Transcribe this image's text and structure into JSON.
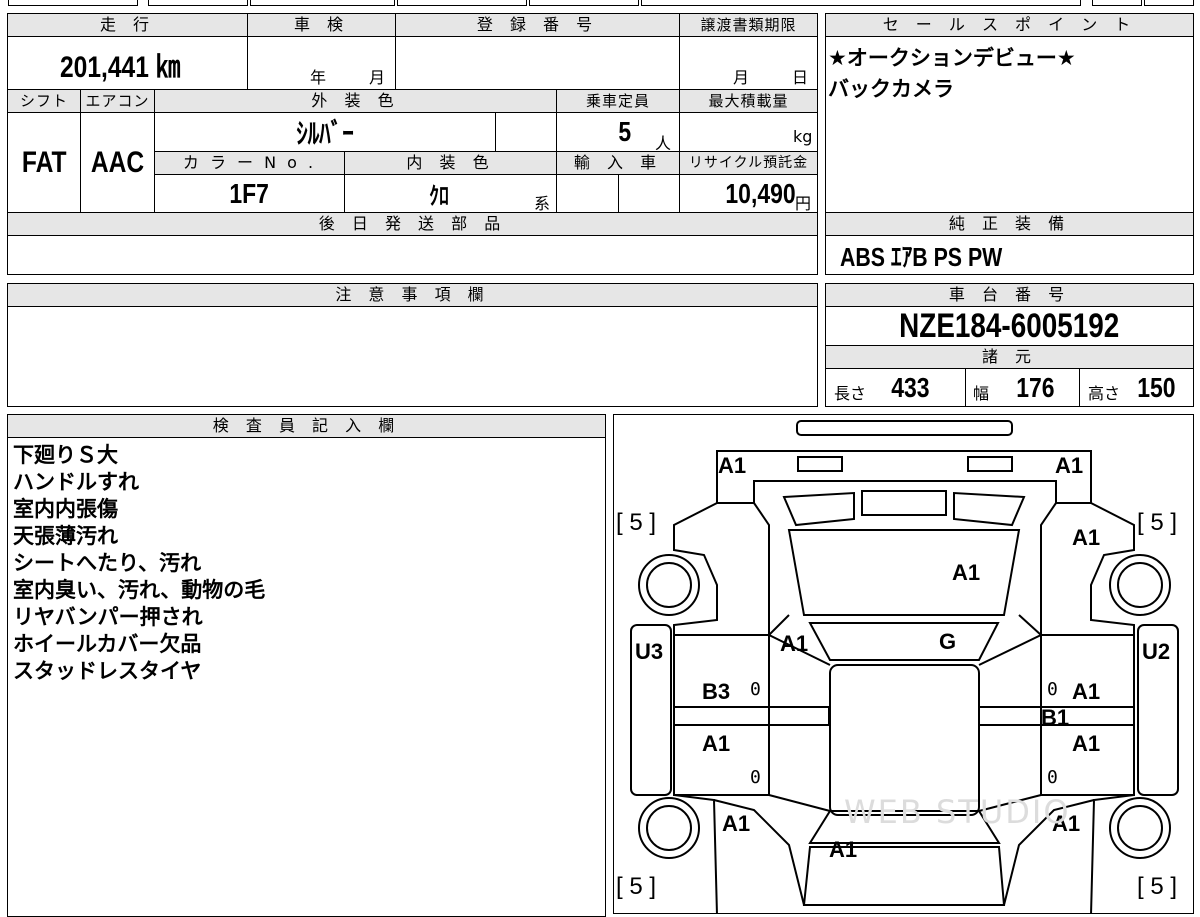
{
  "top_row": {
    "mileage_header": "走 行",
    "shaken_header": "車 検",
    "reg_header": "登 録 番 号",
    "transfer_header": "譲渡書類期限",
    "mileage_value": "201,441 ㎞",
    "year_label": "年",
    "month_label": "月",
    "transfer_month": "月",
    "transfer_day": "日"
  },
  "spec_row": {
    "shift_header": "シフト",
    "aircon_header": "エアコン",
    "exterior_header": "外 装 色",
    "capacity_header": "乗車定員",
    "maxload_header": "最大積載量",
    "shift_value": "FAT",
    "aircon_value": "AAC",
    "exterior_value": "ｼﾙﾊﾞｰ",
    "capacity_value": "5",
    "capacity_unit": "人",
    "maxload_unit": "kg",
    "colorno_header": "カ ラ ー N o .",
    "interior_header": "内 装 色",
    "import_header": "輸 入 車",
    "recycle_header": "リサイクル預託金",
    "colorno_value": "1F7",
    "interior_value": "ｸﾛ",
    "interior_suffix": "系",
    "recycle_value": "10,490",
    "recycle_unit": "円"
  },
  "later_parts": {
    "header": "後 日 発 送 部 品"
  },
  "notes": {
    "header": "注 意 事 項 欄"
  },
  "sales_points": {
    "header": "セ ー ル ス ポ イ ン ト",
    "lines": [
      "★オークションデビュー★",
      "バックカメラ"
    ]
  },
  "equipment": {
    "header": "純 正 装 備",
    "value": "ABS ｴｱB PS PW"
  },
  "chassis": {
    "header": "車 台 番 号",
    "value": "NZE184-6005192"
  },
  "specs": {
    "header": "諸 元",
    "length_label": "長さ",
    "length_value": "433",
    "width_label": "幅",
    "width_value": "176",
    "height_label": "高さ",
    "height_value": "150"
  },
  "inspector": {
    "header": "検 査 員 記 入 欄",
    "lines": [
      "下廻りＳ大",
      "ハンドルすれ",
      "室内内張傷",
      "天張薄汚れ",
      "シートへたり、汚れ",
      "室内臭い、汚れ、動物の毛",
      "リヤバンパー押され",
      "ホイールカバー欠品",
      "スタッドレスタイヤ"
    ]
  },
  "diagram": {
    "marks": {
      "front_left": "A1",
      "front_right": "A1",
      "hood": "A1",
      "windshield": "G",
      "fender_left_front": "A1",
      "fender_right_front": "A1",
      "pillar_left": "U3",
      "pillar_right": "U2",
      "door_left_front": "B3",
      "door_left_rear": "A1",
      "door_right_front": "A1",
      "door_right_rear": "A1",
      "sill_right": "B1",
      "quarter_left": "A1",
      "quarter_right": "A1",
      "rear": "A1"
    },
    "tire_front_left": "[ 5 ]",
    "tire_front_right": "[ 5 ]",
    "tire_rear_left": "[ 5 ]",
    "tire_rear_right": "[ 5 ]",
    "zero": "0",
    "watermark": "WEB STUDIO"
  }
}
